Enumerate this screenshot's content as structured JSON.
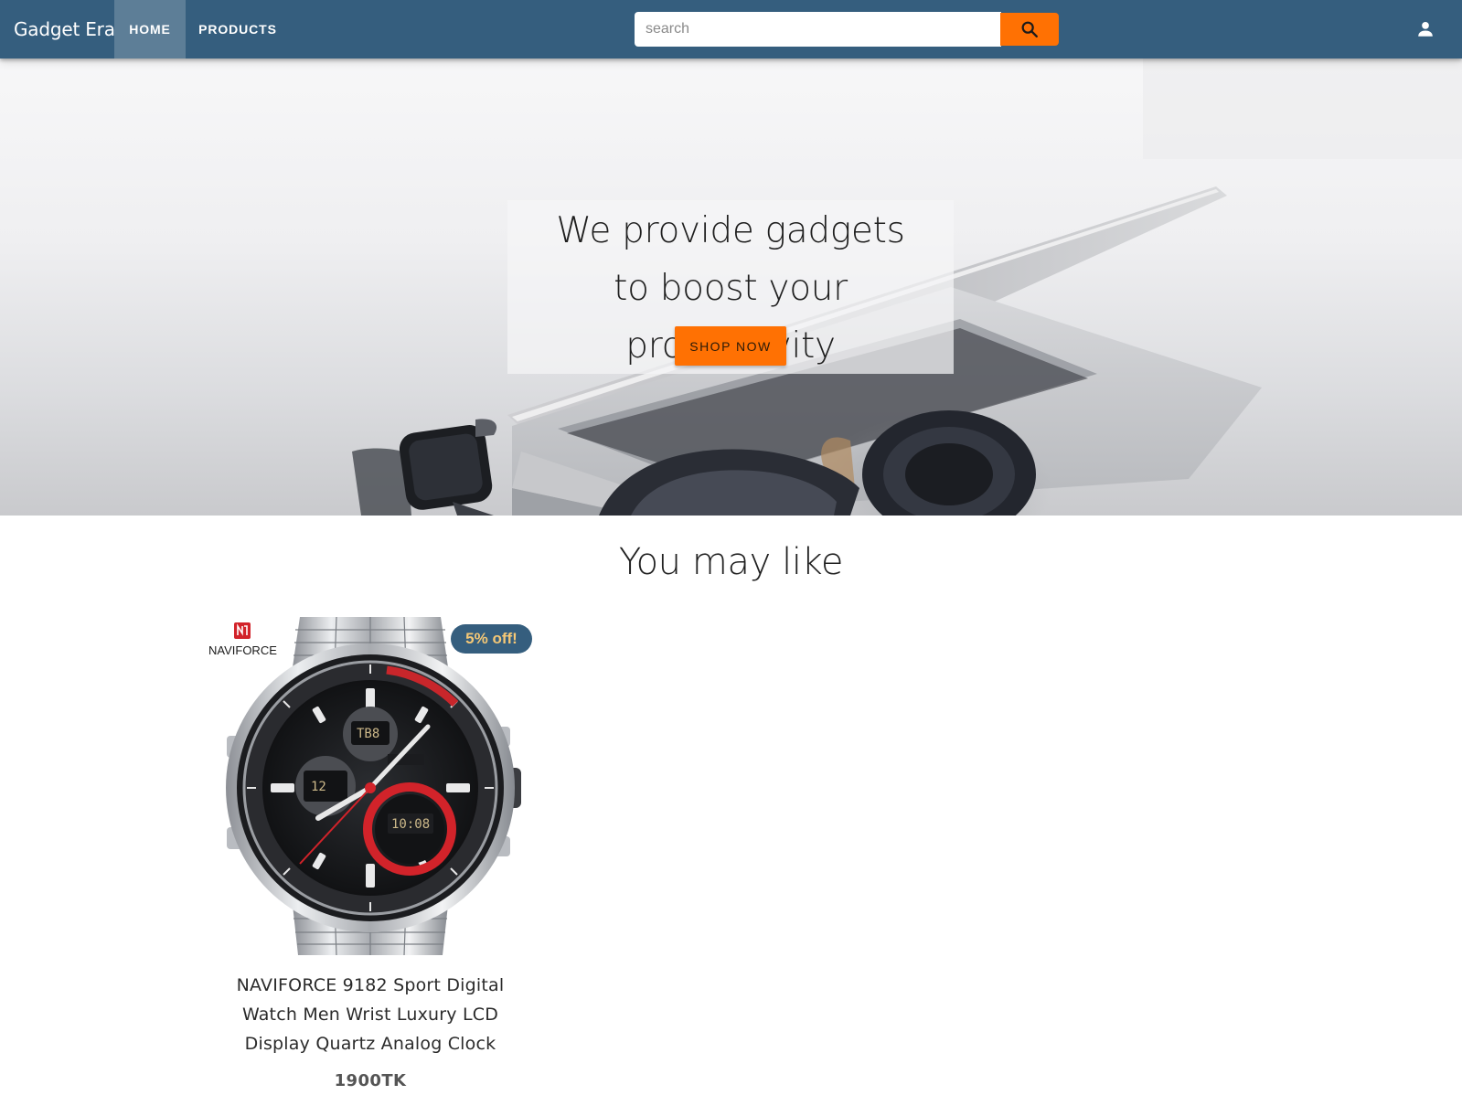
{
  "navbar": {
    "brand": "Gadget Era",
    "tabs": [
      {
        "label": "HOME",
        "active": true
      },
      {
        "label": "PRODUCTS",
        "active": false
      }
    ],
    "search_placeholder": "search",
    "search_value": "",
    "icons": {
      "search": "search-icon",
      "user": "user-icon"
    }
  },
  "hero": {
    "line1": "We provide gadgets",
    "line2": "to boost your productivity",
    "cta_label": "SHOP NOW"
  },
  "section": {
    "title": "You may like"
  },
  "products": [
    {
      "brand_logo": "NAVIFORCE",
      "discount": "5% off!",
      "title": "NAVIFORCE 9182 Sport Digital Watch Men Wrist Luxury LCD Display Quartz Analog Clock",
      "price": "1900TK"
    }
  ],
  "colors": {
    "navbar": "#355e7e",
    "accent": "#ff7103",
    "badge_bg": "#355e7e",
    "badge_text": "#f5c876"
  }
}
